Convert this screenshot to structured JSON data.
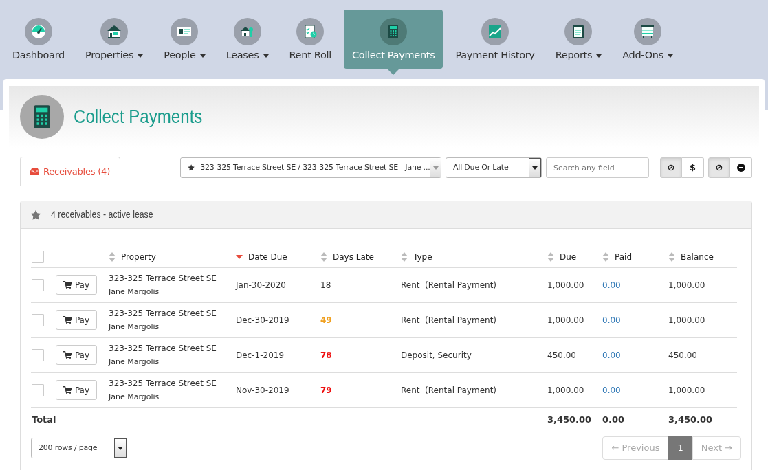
{
  "nav": [
    {
      "label": "Dashboard",
      "dropdown": false,
      "selected": false
    },
    {
      "label": "Properties",
      "dropdown": true,
      "selected": false
    },
    {
      "label": "People",
      "dropdown": true,
      "selected": false
    },
    {
      "label": "Leases",
      "dropdown": true,
      "selected": false
    },
    {
      "label": "Rent Roll",
      "dropdown": false,
      "selected": false
    },
    {
      "label": "Collect Payments",
      "dropdown": false,
      "selected": true
    },
    {
      "label": "Payment History",
      "dropdown": false,
      "selected": false
    },
    {
      "label": "Reports",
      "dropdown": true,
      "selected": false
    },
    {
      "label": "Add-Ons",
      "dropdown": true,
      "selected": false
    }
  ],
  "page_title": "Collect Payments",
  "tabs": [
    {
      "label": "Receivables (4)",
      "selected": true
    }
  ],
  "filters": {
    "lease_select": "323-325 Terrace Street SE / 323-325 Terrace Street SE - Jane ...",
    "status_select": "All Due Or Late",
    "search": {
      "placeholder": "Search any field"
    }
  },
  "toggle_groups": [
    [
      {
        "kind": "text",
        "label": "⊘",
        "on": true
      },
      {
        "kind": "text",
        "label": "$",
        "on": false
      }
    ],
    [
      {
        "kind": "text",
        "label": "⊘",
        "on": true
      },
      {
        "kind": "minus",
        "on": false
      }
    ]
  ],
  "panel_title": "4 receivables - active lease",
  "table": {
    "columns": [
      {
        "label": "Property",
        "sorted": false
      },
      {
        "label": "Date Due",
        "sorted": true
      },
      {
        "label": "Days Late",
        "sorted": false
      },
      {
        "label": "Type",
        "sorted": false
      },
      {
        "label": "Due",
        "sorted": false
      },
      {
        "label": "Paid",
        "sorted": false
      },
      {
        "label": "Balance",
        "sorted": false
      }
    ],
    "header_checked": false,
    "rows": [
      {
        "checked": false,
        "action": "Pay",
        "property": "323-325 Terrace Street SE",
        "tenant": "Jane Margolis",
        "date_due": "Jan-30-2020",
        "days_late": "18",
        "color": "#333333",
        "type": "Rent  (Rental Payment)",
        "due": "1,000.00",
        "paid": "0.00",
        "balance": "1,000.00"
      },
      {
        "checked": false,
        "action": "Pay",
        "property": "323-325 Terrace Street SE",
        "tenant": "Jane Margolis",
        "date_due": "Dec-30-2019",
        "days_late": "49",
        "color": "#f0a020",
        "type": "Rent  (Rental Payment)",
        "due": "1,000.00",
        "paid": "0.00",
        "balance": "1,000.00"
      },
      {
        "checked": false,
        "action": "Pay",
        "property": "323-325 Terrace Street SE",
        "tenant": "Jane Margolis",
        "date_due": "Dec-1-2019",
        "days_late": "78",
        "color": "#ee1111",
        "type": "Deposit, Security",
        "due": "450.00",
        "paid": "0.00",
        "balance": "450.00"
      },
      {
        "checked": false,
        "action": "Pay",
        "property": "323-325 Terrace Street SE",
        "tenant": "Jane Margolis",
        "date_due": "Nov-30-2019",
        "days_late": "79",
        "color": "#ee1111",
        "type": "Rent  (Rental Payment)",
        "due": "1,000.00",
        "paid": "0.00",
        "balance": "1,000.00"
      }
    ],
    "total": {
      "label": "Total",
      "due": "3,450.00",
      "paid": "0.00",
      "balance": "3,450.00"
    }
  },
  "page_size": "200 rows / page",
  "pagination": [
    {
      "label": "← Previous",
      "selected": false
    },
    {
      "label": "1",
      "selected": true
    },
    {
      "label": "Next →",
      "selected": false
    }
  ]
}
